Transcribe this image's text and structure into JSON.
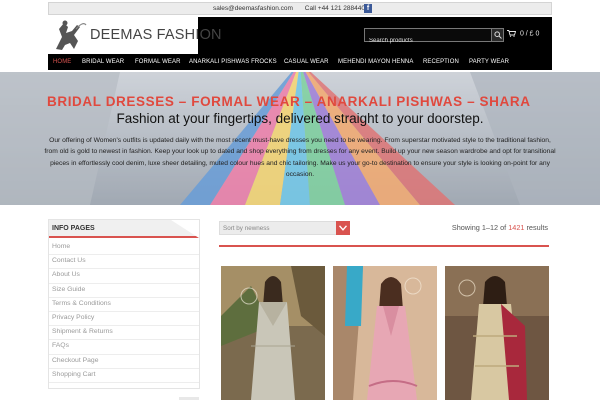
{
  "topbar": {
    "email": "sales@deemasfashion.com",
    "phone": "Call +44 121 2884400",
    "social_icon": "facebook-icon"
  },
  "header": {
    "logo_text": "DEEMAS FASHION",
    "search_placeholder": "Search products",
    "cart_text": "0 / £ 0",
    "cart_icon": "cart-icon"
  },
  "nav": {
    "items": [
      {
        "label": "HOME",
        "active": true
      },
      {
        "label": "BRIDAL WEAR"
      },
      {
        "label": "FORMAL WEAR"
      },
      {
        "label": "ANARKALI PISHWAS FROCKS"
      },
      {
        "label": "CASUAL WEAR"
      },
      {
        "label": "MEHENDI MAYON HENNA"
      },
      {
        "label": "RECEPTION"
      },
      {
        "label": "PARTY WEAR"
      }
    ]
  },
  "hero": {
    "title": "BRIDAL DRESSES – FORMAL WEAR – ANARKALI PISHWAS – SHARA",
    "subtitle": "Fashion at your fingertips, delivered straight to your doorstep.",
    "body": "Our offering of Women's outfits is updated daily with the most recent must-have dresses you need to be wearing. From superstar motivated style to the traditional fashion, from old is gold to newest in fashion. Keep your look up to dated and shop everything from dresses for any event. Build up your new season wardrobe and opt for transitional pieces in effortlessly cool denim, luxe sheer detailing, muted colour hues and chic tailoring. Make us your go-to destination to ensure your style is looking on-point for any occasion."
  },
  "sidebar": {
    "title": "INFO PAGES",
    "links": [
      "Home",
      "Contact Us",
      "About Us",
      "Size Guide",
      "Terms & Conditions",
      "Privacy Policy",
      "Shipment & Returns",
      "FAQs",
      "Checkout Page",
      "Shopping Cart"
    ]
  },
  "shop": {
    "sort_label": "Sort by newness",
    "results_prefix": "Showing 1–12 of",
    "results_total": "1421",
    "results_suffix": "results"
  },
  "colors": {
    "accent": "#d9534f",
    "header_bg": "#000000",
    "hero_title": "#e0493e"
  }
}
